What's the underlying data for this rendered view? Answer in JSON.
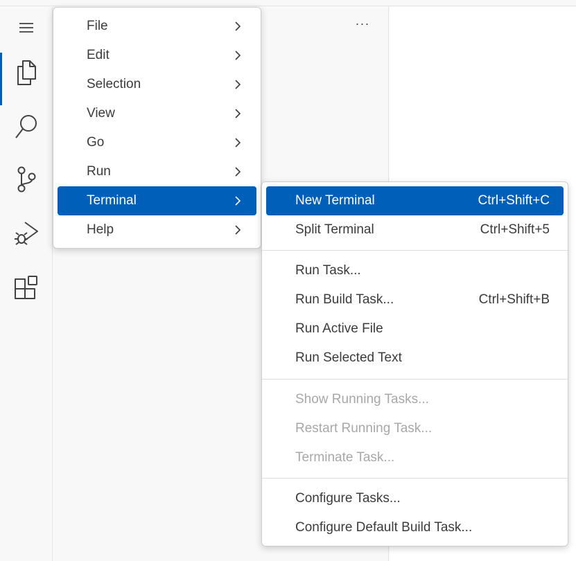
{
  "activity_bar": {
    "icons": [
      "menu-icon",
      "files-icon",
      "search-icon",
      "source-control-icon",
      "run-debug-icon",
      "extensions-icon"
    ]
  },
  "sidebar": {
    "more_label": "···"
  },
  "main_menu": {
    "items": [
      {
        "label": "File"
      },
      {
        "label": "Edit"
      },
      {
        "label": "Selection"
      },
      {
        "label": "View"
      },
      {
        "label": "Go"
      },
      {
        "label": "Run"
      },
      {
        "label": "Terminal",
        "selected": true
      },
      {
        "label": "Help"
      }
    ]
  },
  "terminal_menu": {
    "items": [
      {
        "label": "New Terminal",
        "shortcut": "Ctrl+Shift+C",
        "selected": true
      },
      {
        "label": "Split Terminal",
        "shortcut": "Ctrl+Shift+5"
      },
      {
        "label": "Run Task..."
      },
      {
        "label": "Run Build Task...",
        "shortcut": "Ctrl+Shift+B"
      },
      {
        "label": "Run Active File"
      },
      {
        "label": "Run Selected Text"
      },
      {
        "label": "Show Running Tasks...",
        "disabled": true
      },
      {
        "label": "Restart Running Task...",
        "disabled": true
      },
      {
        "label": "Terminate Task...",
        "disabled": true
      },
      {
        "label": "Configure Tasks..."
      },
      {
        "label": "Configure Default Build Task..."
      }
    ]
  },
  "colors": {
    "accent": "#005fb8",
    "menu_background": "#ffffff",
    "disabled_text": "#a8a8a8"
  }
}
